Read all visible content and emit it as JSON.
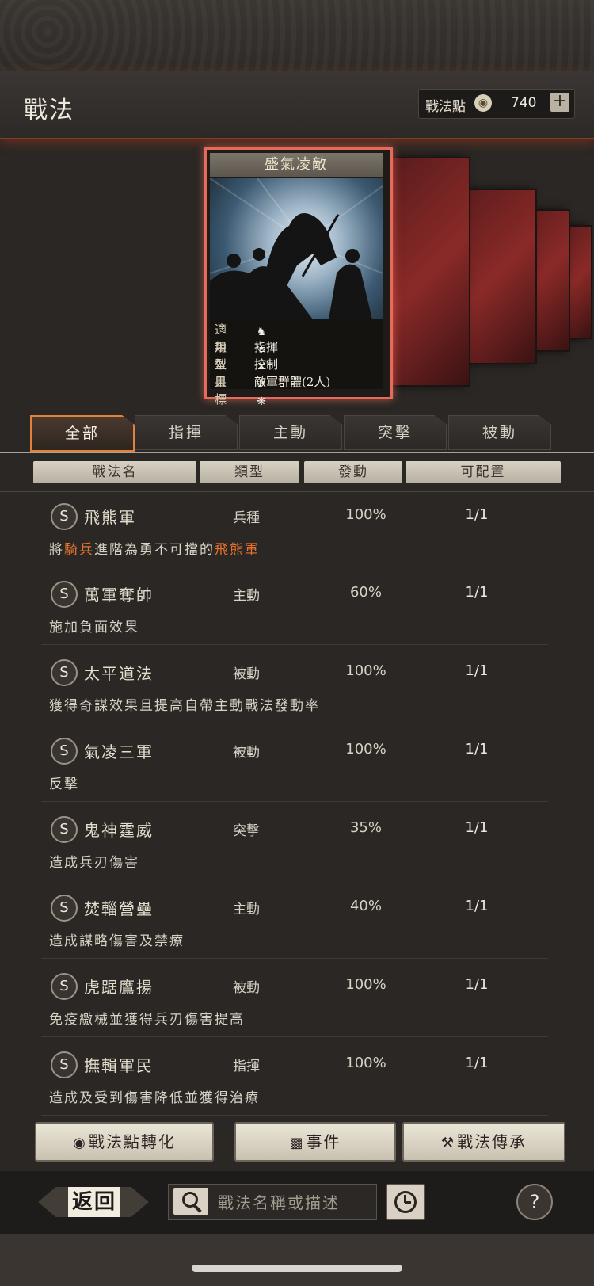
{
  "header": {
    "title": "戰法",
    "points_label": "戰法點",
    "points_icon": "ink-drop-icon",
    "points_value": "740",
    "add_icon": "plus-icon"
  },
  "card": {
    "title": "盛氣凌敵",
    "rows": [
      {
        "key": "適用",
        "value": ""
      },
      {
        "key": "類型",
        "value": "指揮"
      },
      {
        "key": "效果",
        "value": "控制"
      },
      {
        "key": "目標",
        "value": "敵軍群體(2人)"
      }
    ],
    "troop_icons": [
      "cavalry-icon",
      "shield-icon",
      "bow-icon",
      "spear-icon",
      "siege-icon"
    ]
  },
  "tabs": [
    "全部",
    "指揮",
    "主動",
    "突擊",
    "被動"
  ],
  "columns": [
    "戰法名",
    "類型",
    "發動",
    "可配置"
  ],
  "skills": [
    {
      "grade": "S",
      "name": "飛熊軍",
      "type": "兵種",
      "rate": "100%",
      "slots": "1/1",
      "desc_parts": [
        "將",
        "騎兵",
        "進階為勇不可擋的",
        "飛熊軍"
      ]
    },
    {
      "grade": "S",
      "name": "萬軍奪帥",
      "type": "主動",
      "rate": "60%",
      "slots": "1/1",
      "desc": "施加負面效果"
    },
    {
      "grade": "S",
      "name": "太平道法",
      "type": "被動",
      "rate": "100%",
      "slots": "1/1",
      "desc": "獲得奇謀效果且提高自帶主動戰法發動率"
    },
    {
      "grade": "S",
      "name": "氣凌三軍",
      "type": "被動",
      "rate": "100%",
      "slots": "1/1",
      "desc": "反擊"
    },
    {
      "grade": "S",
      "name": "鬼神霆威",
      "type": "突擊",
      "rate": "35%",
      "slots": "1/1",
      "desc": "造成兵刃傷害"
    },
    {
      "grade": "S",
      "name": "焚輜營壘",
      "type": "主動",
      "rate": "40%",
      "slots": "1/1",
      "desc": "造成謀略傷害及禁療"
    },
    {
      "grade": "S",
      "name": "虎踞鷹揚",
      "type": "被動",
      "rate": "100%",
      "slots": "1/1",
      "desc": "免疫繳械並獲得兵刃傷害提高"
    },
    {
      "grade": "S",
      "name": "撫輯軍民",
      "type": "指揮",
      "rate": "100%",
      "slots": "1/1",
      "desc": "造成及受到傷害降低並獲得治療"
    }
  ],
  "actions": {
    "convert": "戰法點轉化",
    "event": "事件",
    "inherit": "戰法傳承"
  },
  "footer": {
    "back": "返回",
    "search_placeholder": "戰法名稱或描述",
    "help": "?"
  },
  "colors": {
    "accent": "#e8732f",
    "card_border": "#e86a58"
  }
}
